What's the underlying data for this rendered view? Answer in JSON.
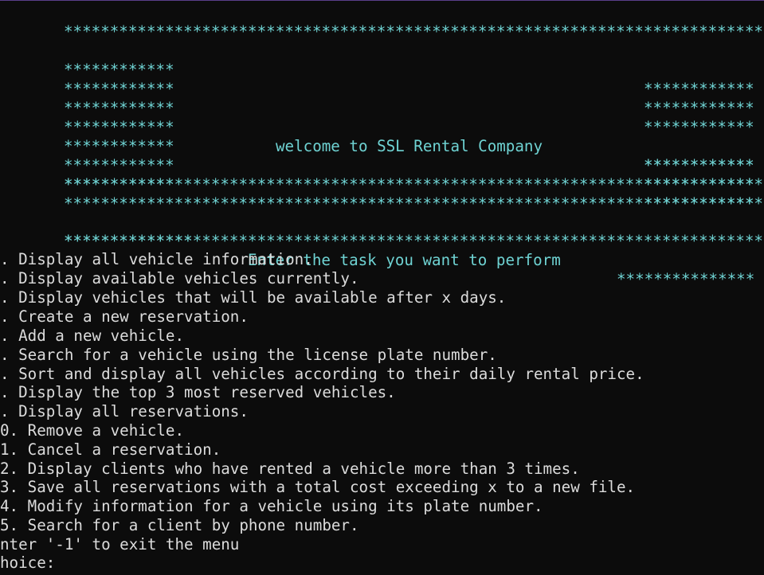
{
  "banner": {
    "full_star_row": "**********************************************************************************************",
    "side_stars": "************",
    "welcome": "welcome to SSL Rental Company",
    "task_left_stars": "**************",
    "task_prompt": "Enter the task you want to perform",
    "task_right_stars": "***************"
  },
  "menu": {
    "items": [
      ". Display all vehicle information.",
      ". Display available vehicles currently.",
      ". Display vehicles that will be available after x days.",
      ". Create a new reservation.",
      ". Add a new vehicle.",
      ". Search for a vehicle using the license plate number.",
      ". Sort and display all vehicles according to their daily rental price.",
      ". Display the top 3 most reserved vehicles.",
      ". Display all reservations.",
      "0. Remove a vehicle.",
      "1. Cancel a reservation.",
      "2. Display clients who have rented a vehicle more than 3 times.",
      "3. Save all reservations with a total cost exceeding x to a new file.",
      "4. Modify information for a vehicle using its plate number.",
      "5. Search for a client by phone number."
    ],
    "exit_hint": "nter '-1' to exit the menu",
    "choice_prompt": "hoice:"
  },
  "colors": {
    "background": "#0c0c0c",
    "banner_text": "#6fd3d3",
    "menu_text": "#dcdcdc"
  }
}
